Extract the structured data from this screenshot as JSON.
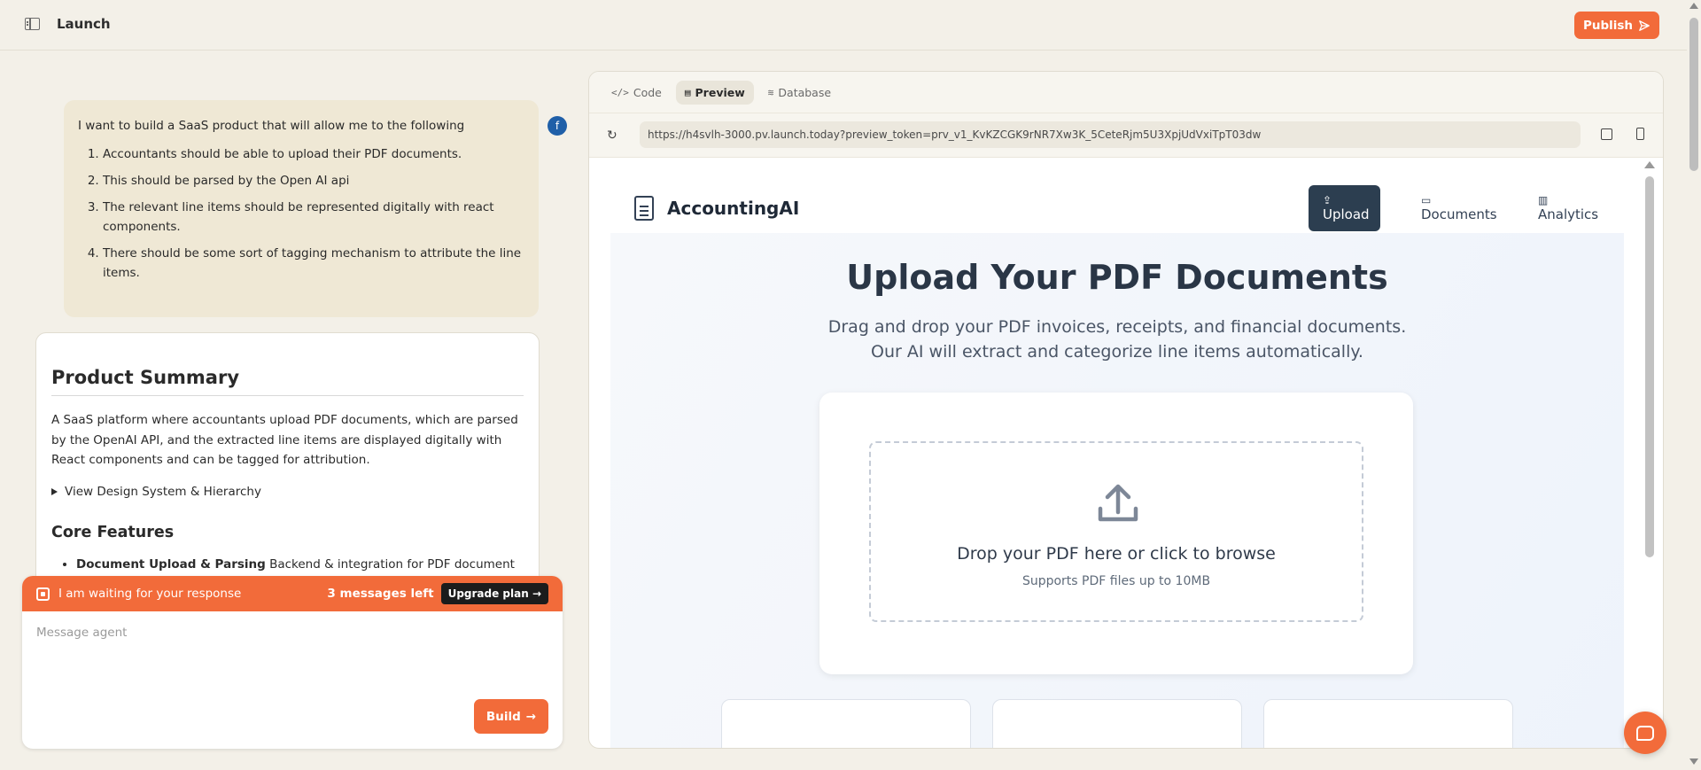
{
  "header": {
    "title": "Launch",
    "publish_label": "Publish"
  },
  "chat": {
    "user_avatar_initial": "f",
    "user_message": {
      "intro": "I want to build a SaaS product that will allow me to the following",
      "items": [
        "Accountants should be able to upload their PDF documents.",
        "This should be parsed by the Open AI api",
        "The relevant line items should be represented digitally with react components.",
        "There should be some sort of tagging mechanism to attribute the line items."
      ]
    },
    "summary": {
      "title": "Product Summary",
      "text": "A SaaS platform where accountants upload PDF documents, which are parsed by the OpenAI API, and the extracted line items are displayed digitally with React components and can be tagged for attribution.",
      "details_label": "View Design System & Hierarchy",
      "core_title": "Core Features",
      "core_first_bold": "Document Upload & Parsing",
      "core_first_rest": " Backend & integration for PDF document"
    },
    "status": {
      "text": "I am waiting for your response",
      "messages_left": "3 messages left",
      "upgrade_label": "Upgrade plan →"
    },
    "composer": {
      "placeholder": "Message agent",
      "build_label": "Build"
    }
  },
  "preview": {
    "tabs": [
      {
        "label": "Code",
        "icon": "code-icon"
      },
      {
        "label": "Preview",
        "icon": "layout-icon"
      },
      {
        "label": "Database",
        "icon": "database-icon"
      }
    ],
    "url": "https://h4svlh-3000.pv.launch.today?preview_token=prv_v1_KvKZCGK9rNR7Xw3K_5CeteRjm5U3XpjUdVxiTpT03dw",
    "app": {
      "brand": "AccountingAI",
      "nav": [
        {
          "label": "Upload",
          "icon": "upload-icon"
        },
        {
          "label": "Documents",
          "icon": "folder-icon"
        },
        {
          "label": "Analytics",
          "icon": "bar-chart-icon"
        }
      ],
      "hero_title": "Upload Your PDF Documents",
      "hero_sub_line1": "Drag and drop your PDF invoices, receipts, and financial documents.",
      "hero_sub_line2": "Our AI will extract and categorize line items automatically.",
      "drop_title": "Drop your PDF here or click to browse",
      "drop_sub": "Supports PDF files up to 10MB"
    }
  },
  "colors": {
    "accent": "#f26b3a",
    "app_nav_active": "#2c3e50",
    "page_bg": "#f3f0e8"
  }
}
